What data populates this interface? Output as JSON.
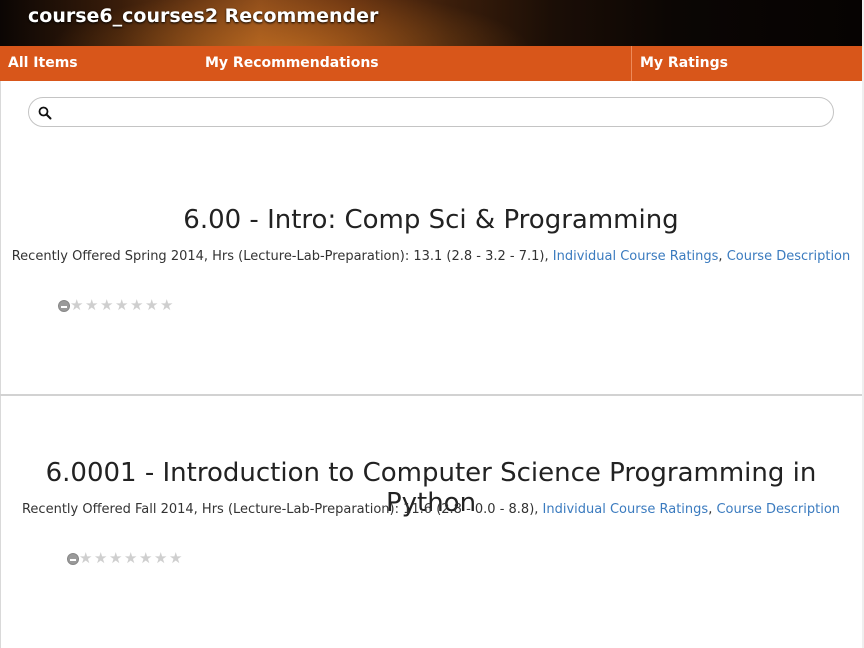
{
  "app": {
    "title": "course6_courses2 Recommender"
  },
  "nav": {
    "items": [
      {
        "label": "All Items"
      },
      {
        "label": "My Recommendations"
      },
      {
        "label": "My Ratings"
      }
    ]
  },
  "search": {
    "value": "",
    "placeholder": "",
    "icon": "search-icon"
  },
  "courses": [
    {
      "title": "6.00 - Intro: Comp Sci & Programming",
      "meta": "Recently Offered Spring 2014, Hrs (Lecture-Lab-Preparation): 13.1 (2.8 - 3.2 - 7.1), ",
      "ratings_link": "Individual Course Ratings",
      "separator": ", ",
      "description_link": "Course Description",
      "rating": {
        "max_stars": 7,
        "value": 0
      }
    },
    {
      "title": "6.0001 - Introduction to Computer Science Programming in Python",
      "meta": "Recently Offered Fall 2014, Hrs (Lecture-Lab-Preparation): 11.6 (2.8 - 0.0 - 8.8), ",
      "ratings_link": "Individual Course Ratings",
      "separator": ", ",
      "description_link": "Course Description",
      "rating": {
        "max_stars": 7,
        "value": 0
      }
    }
  ],
  "colors": {
    "nav": "#d8561a",
    "link": "#3b7bbf",
    "star_empty": "#cfcfcf"
  }
}
